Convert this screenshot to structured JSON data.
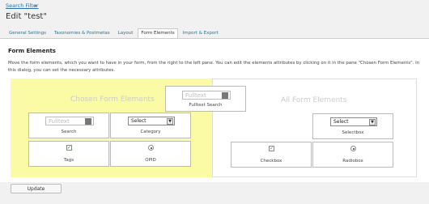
{
  "breadcrumb": {
    "link_label": "Search Filter",
    "separator": "»"
  },
  "page_title": "Edit \"test\"",
  "tabs": [
    {
      "label": "General Settings"
    },
    {
      "label": "Taxonomies & Postmetas"
    },
    {
      "label": "Layout"
    },
    {
      "label": "Form Elements",
      "active": true
    },
    {
      "label": "Import & Export"
    }
  ],
  "section": {
    "title": "Form Elements",
    "description": "Move the form elements, which you want to have in your form, from the right to the left pane. You can edit the elements attributes by clicking on it in the pane \"Chosen Form Elements\". In this dialog, you can set the necessary attributes."
  },
  "chosen_pane": {
    "heading": "Chosen Form Elements",
    "elements": {
      "fulltext_search": {
        "label": "Fulltext Search",
        "placeholder": "Fulltext"
      },
      "search": {
        "label": "Search",
        "placeholder": "Fulltext"
      },
      "category": {
        "label": "Category",
        "select_value": "Select"
      },
      "tags": {
        "label": "Tags"
      },
      "opid": {
        "label": "OPID"
      }
    }
  },
  "all_pane": {
    "heading": "All Form Elements",
    "elements": {
      "selectbox": {
        "label": "Selectbox",
        "select_value": "Select"
      },
      "checkbox": {
        "label": "Checkbox"
      },
      "radiobox": {
        "label": "Radiobox"
      }
    }
  },
  "update_label": "Update",
  "colors": {
    "chosen_pane_bg": "#fbfba6",
    "link": "#2a6fa8",
    "check": "#2a8a2a"
  }
}
